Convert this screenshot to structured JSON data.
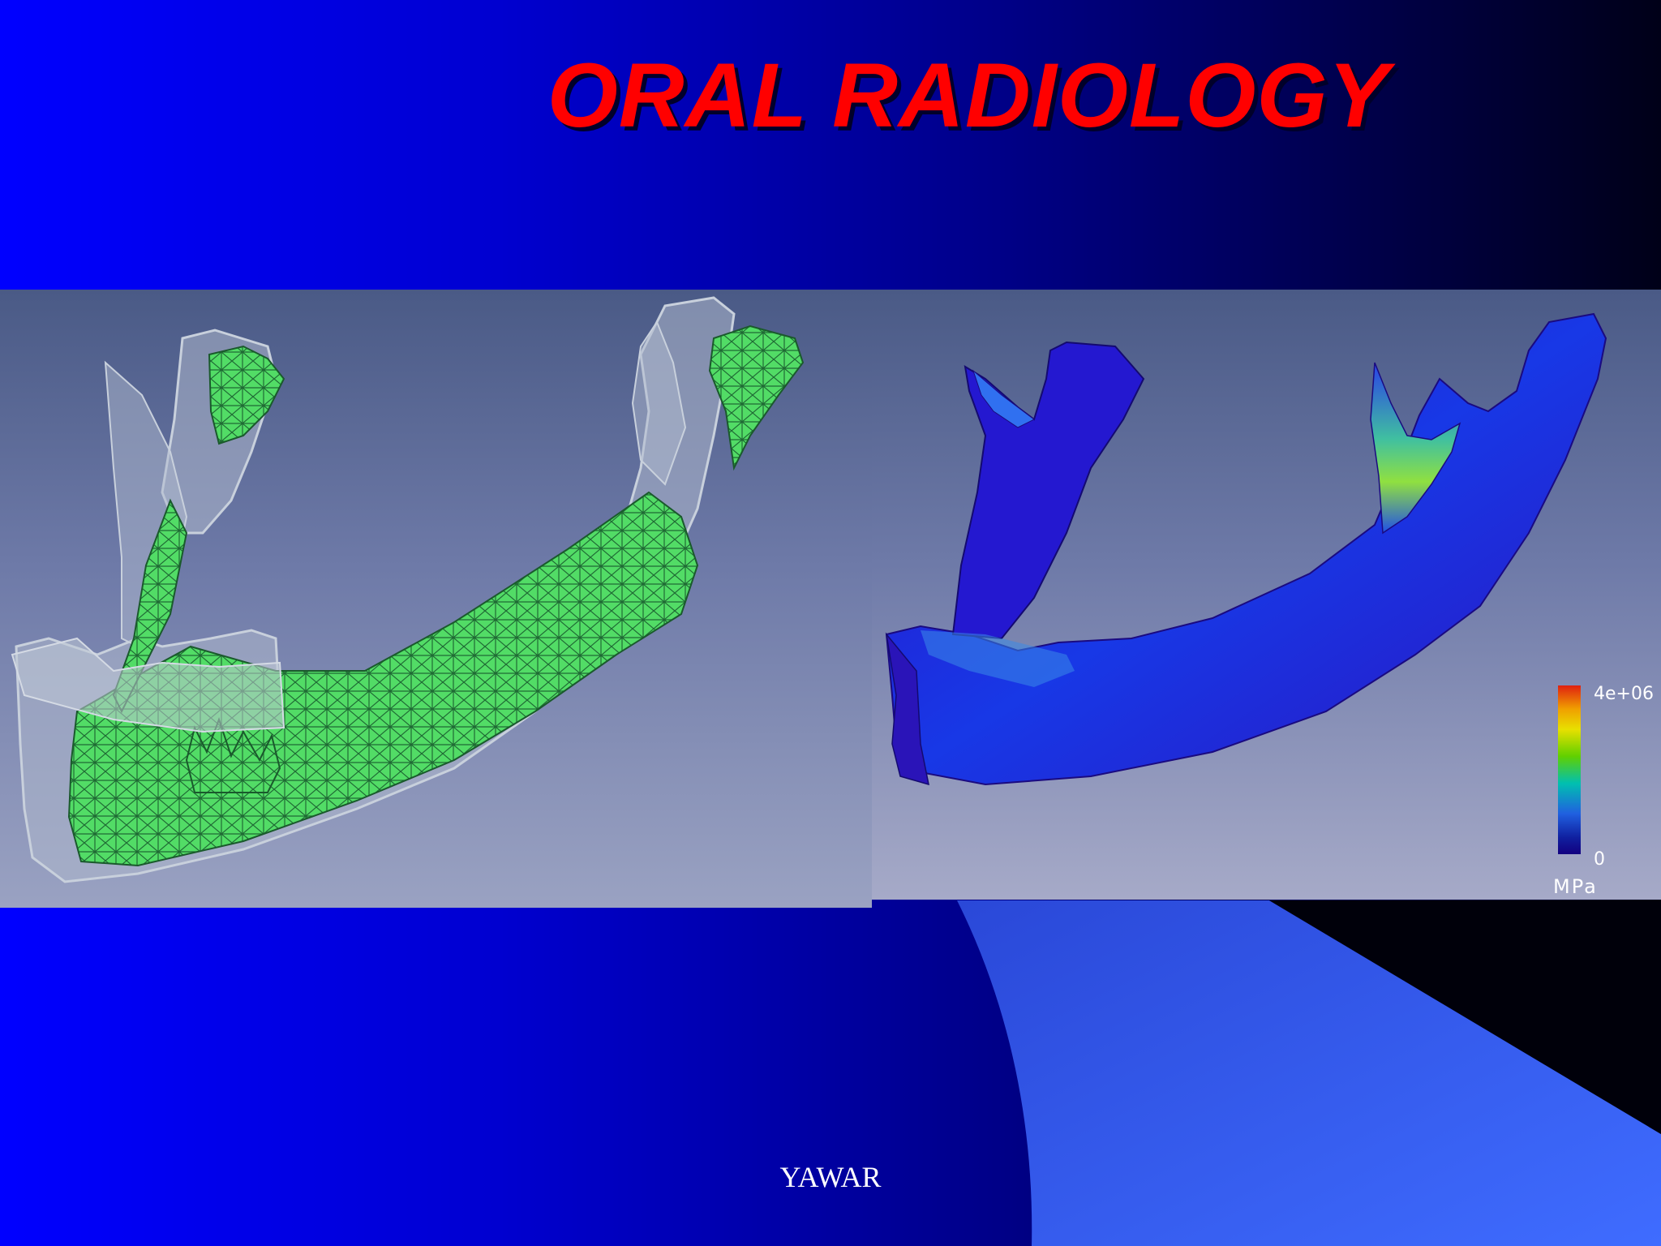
{
  "slide": {
    "title": "ORAL RADIOLOGY",
    "footer": "YAWAR"
  },
  "left_figure": {
    "subject": "mandible finite-element mesh",
    "mesh_color": "#55e06a",
    "shell_color": "#a8b4c8"
  },
  "right_figure": {
    "subject": "mandible stress distribution",
    "scale": {
      "max_label": "4e+06",
      "min_label": "0",
      "unit_label": "MPa"
    }
  },
  "colors": {
    "title": "#ff0000",
    "background_start": "#0000ff",
    "background_end": "#000018",
    "accent_band": "#3a63ff"
  }
}
